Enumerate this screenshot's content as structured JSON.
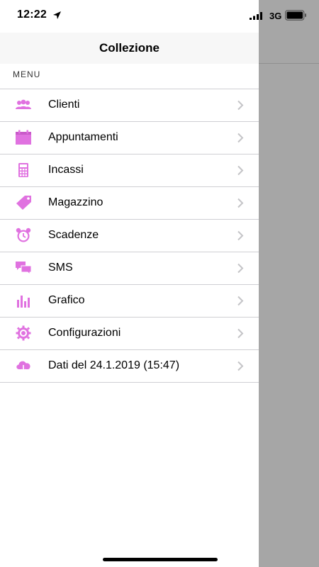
{
  "status_bar": {
    "time": "12:22",
    "network": "3G"
  },
  "nav": {
    "title": "Collezione"
  },
  "section": {
    "header": "MENU"
  },
  "menu": {
    "accent_color": "#e072e0",
    "items": [
      {
        "label": "Clienti",
        "icon": "people-icon"
      },
      {
        "label": "Appuntamenti",
        "icon": "calendar-icon"
      },
      {
        "label": "Incassi",
        "icon": "calculator-icon"
      },
      {
        "label": "Magazzino",
        "icon": "tag-icon"
      },
      {
        "label": "Scadenze",
        "icon": "alarm-clock-icon"
      },
      {
        "label": "SMS",
        "icon": "chat-bubbles-icon"
      },
      {
        "label": "Grafico",
        "icon": "bar-chart-icon"
      },
      {
        "label": "Configurazioni",
        "icon": "gear-icon"
      },
      {
        "label": "Dati del 24.1.2019 (15:47)",
        "icon": "cloud-download-icon"
      }
    ]
  }
}
